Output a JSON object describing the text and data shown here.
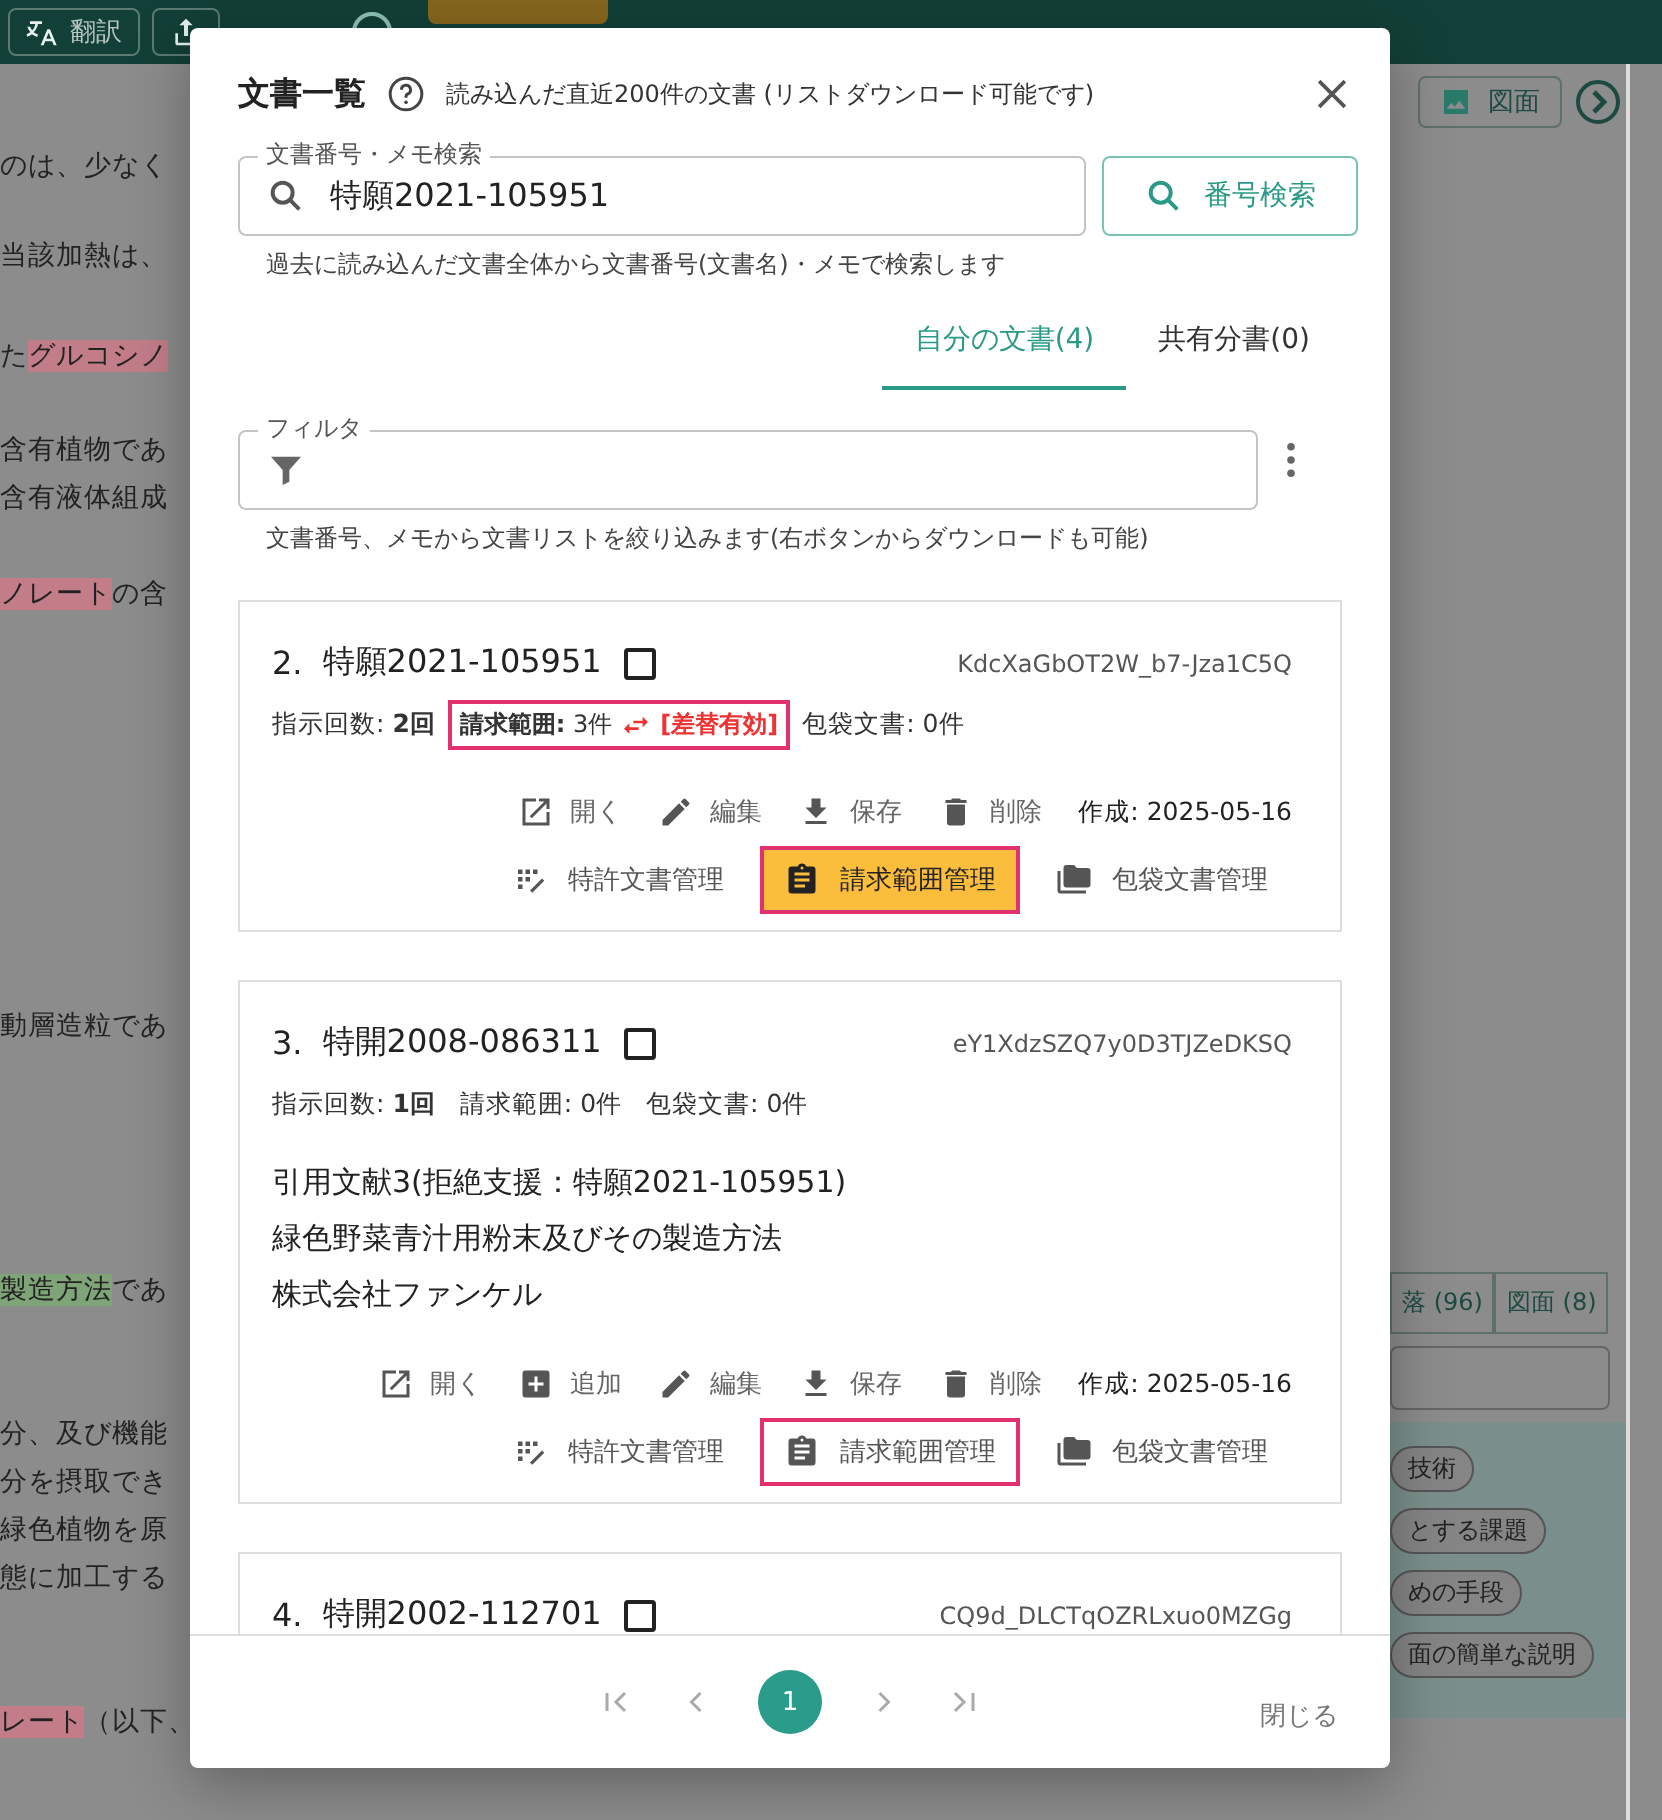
{
  "background": {
    "toolbar": {
      "buttons": [
        {
          "kind": "translate",
          "label": "翻訳"
        },
        {
          "kind": "export"
        }
      ],
      "help": true,
      "rating_button": true
    },
    "figure_button": {
      "label": "図面"
    },
    "paragraphs": [
      {
        "lines": [
          [
            {
              "text": "のは、少なく"
            }
          ]
        ]
      },
      {
        "lines": [
          [
            {
              "text": "当該加熱は、"
            }
          ]
        ]
      },
      {
        "lines": [
          [
            {
              "text": "た"
            },
            {
              "text": "グルコシノ",
              "color": "#c27d89"
            }
          ]
        ]
      },
      {
        "lines": [
          [
            {
              "text": "含有植物であ"
            }
          ],
          [
            {
              "text": "含有液体組成"
            }
          ]
        ]
      },
      {
        "lines": [
          [
            {
              "text": "ノレート",
              "color": "#c27d89"
            },
            {
              "text": "の含"
            }
          ]
        ]
      },
      {
        "lines": [
          [
            {
              "text": "動層造粒であ"
            }
          ]
        ]
      },
      {
        "lines": [
          [
            {
              "text": "製造方法",
              "color": "#7fa477"
            },
            {
              "text": "であ"
            }
          ]
        ]
      },
      {
        "lines": [
          [
            {
              "text": "分、及び機能"
            }
          ],
          [
            {
              "text": "分を摂取でき"
            }
          ],
          [
            {
              "text": "緑色植物を原"
            }
          ],
          [
            {
              "text": "態に加工する"
            }
          ]
        ]
      },
      {
        "lines": [
          [
            {
              "text": "レート",
              "color": "#c27d89"
            },
            {
              "text": "（以下、"
            }
          ]
        ]
      }
    ],
    "side_panel": {
      "tabs": [
        {
          "label": "落 (96)",
          "selected": false
        },
        {
          "label": "図面 (8)",
          "selected": false
        }
      ],
      "chips": [
        "技術",
        "とする課題",
        "めの手段",
        "面の簡単な説明"
      ]
    }
  },
  "dialog": {
    "title": "文書一覧",
    "subtitle": "読み込んだ直近200件の文書 (リストダウンロード可能です)",
    "search": {
      "label": "文書番号・メモ検索",
      "value": "特願2021-105951",
      "button": "番号検索",
      "helper": "過去に読み込んだ文書全体から文書番号(文書名)・メモで検索します"
    },
    "tabs": [
      {
        "label": "自分の文書(4)",
        "selected": true
      },
      {
        "label": "共有分書(0)",
        "selected": false
      }
    ],
    "filter": {
      "label": "フィルタ",
      "helper": "文書番号、メモから文書リストを絞り込みます(右ボタンからダウンロードも可能)"
    },
    "documents": [
      {
        "index": "2.",
        "number": "特願2021-105951",
        "checked": false,
        "doc_id": "KdcXaGbOT2W_b7-Jza1C5Q",
        "instructions": "指示回数: **2回**",
        "claims": {
          "text": "**請求範囲:** 3件",
          "replaced": true,
          "replaced_label": "[差替有効]",
          "highlighted": true
        },
        "wrapper": "包袋文書: 0件",
        "actions": [
          {
            "kind": "open",
            "label": "開く"
          },
          {
            "kind": "edit",
            "label": "編集"
          },
          {
            "kind": "save",
            "label": "保存"
          },
          {
            "kind": "delete",
            "label": "削除"
          }
        ],
        "created": "作成: 2025-05-16",
        "manage": [
          {
            "kind": "patent",
            "label": "特許文書管理",
            "active": false,
            "highlighted": false
          },
          {
            "kind": "claims",
            "label": "請求範囲管理",
            "active": true,
            "highlighted": true
          },
          {
            "kind": "wrapper",
            "label": "包袋文書管理",
            "active": false,
            "highlighted": false
          }
        ]
      },
      {
        "index": "3.",
        "number": "特開2008-086311",
        "checked": false,
        "doc_id": "eY1XdzSZQ7y0D3TJZeDKSQ",
        "instructions": "指示回数: **1回**",
        "claims": {
          "text": "請求範囲: 0件",
          "replaced": false,
          "highlighted": false
        },
        "wrapper": "包袋文書: 0件",
        "memo": [
          "引用文献3(拒絶支援：特願2021-105951)",
          "緑色野菜青汁用粉末及びその製造方法",
          "株式会社ファンケル"
        ],
        "actions": [
          {
            "kind": "open",
            "label": "開く"
          },
          {
            "kind": "add",
            "label": "追加"
          },
          {
            "kind": "edit",
            "label": "編集"
          },
          {
            "kind": "save",
            "label": "保存"
          },
          {
            "kind": "delete",
            "label": "削除"
          }
        ],
        "created": "作成: 2025-05-16",
        "manage": [
          {
            "kind": "patent",
            "label": "特許文書管理",
            "active": false,
            "highlighted": false
          },
          {
            "kind": "claims",
            "label": "請求範囲管理",
            "active": false,
            "highlighted": true
          },
          {
            "kind": "wrapper",
            "label": "包袋文書管理",
            "active": false,
            "highlighted": false
          }
        ]
      },
      {
        "index": "4.",
        "number": "特開2002-112701",
        "checked": false,
        "doc_id": "CQ9d_DLCTqOZRLxuo0MZGg"
      }
    ],
    "pages": [
      {
        "label": "1",
        "selected": true
      }
    ],
    "close_label": "閉じる"
  }
}
